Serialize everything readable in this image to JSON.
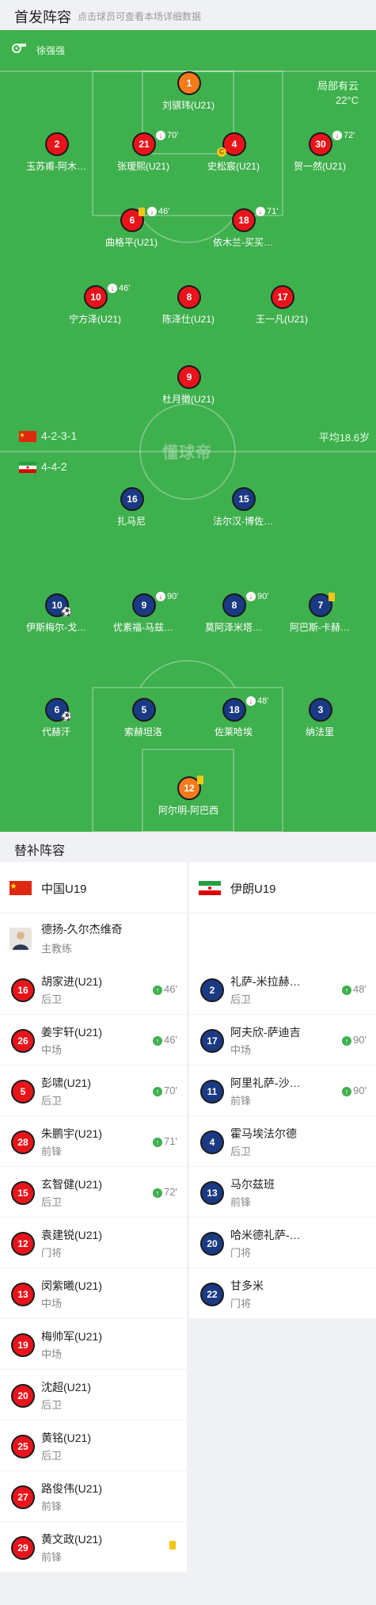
{
  "header": {
    "title": "首发阵容",
    "hint": "点击球员可查看本场详细数据"
  },
  "pitch": {
    "referee": "徐强强",
    "weather": "局部有云",
    "temperature": "22°C",
    "home_formation": "4-2-3-1",
    "away_formation": "4-4-2",
    "home_avg_age": "平均18.6岁",
    "watermark": "懂球帝",
    "home": [
      {
        "num": "1",
        "name": "刘骐玮(U21)",
        "color": "gk"
      },
      {
        "num": "2",
        "name": "玉苏甫-阿木…",
        "color": "red"
      },
      {
        "num": "21",
        "name": "张瑷熙(U21)",
        "color": "red",
        "sub": "70'"
      },
      {
        "num": "4",
        "name": "史松宸(U21)",
        "color": "red",
        "captain": "C"
      },
      {
        "num": "30",
        "name": "贺一然(U21)",
        "color": "red",
        "sub": "72'"
      },
      {
        "num": "6",
        "name": "曲格平(U21)",
        "color": "red",
        "sub": "46'",
        "card": "yellow"
      },
      {
        "num": "18",
        "name": "依木兰-买买…",
        "color": "red",
        "sub": "71'"
      },
      {
        "num": "10",
        "name": "宁方泽(U21)",
        "color": "red",
        "sub": "46'"
      },
      {
        "num": "8",
        "name": "陈泽仕(U21)",
        "color": "red"
      },
      {
        "num": "17",
        "name": "王一凡(U21)",
        "color": "red"
      },
      {
        "num": "9",
        "name": "杜月徵(U21)",
        "color": "red"
      }
    ],
    "away": [
      {
        "num": "16",
        "name": "扎马尼",
        "color": "blue"
      },
      {
        "num": "15",
        "name": "法尔汉-博佐…",
        "color": "blue"
      },
      {
        "num": "10",
        "name": "伊斯梅尔-戈…",
        "color": "blue",
        "goal": "1"
      },
      {
        "num": "9",
        "name": "优素福-马兹…",
        "color": "blue",
        "sub": "90'"
      },
      {
        "num": "8",
        "name": "莫阿泽米塔…",
        "color": "blue",
        "sub": "90'"
      },
      {
        "num": "7",
        "name": "阿巴斯-卡赫…",
        "color": "blue",
        "card": "yellow"
      },
      {
        "num": "6",
        "name": "代赫汗",
        "color": "blue",
        "goal": "1"
      },
      {
        "num": "5",
        "name": "索赫坦洛",
        "color": "blue"
      },
      {
        "num": "18",
        "name": "佐莱哈埃",
        "color": "blue",
        "sub": "48'"
      },
      {
        "num": "3",
        "name": "纳法里",
        "color": "blue"
      },
      {
        "num": "12",
        "name": "阿尔明-阿巴西",
        "color": "gk",
        "card": "yellow"
      }
    ]
  },
  "subs": {
    "title": "替补阵容",
    "home": {
      "team": "中国U19",
      "coach": {
        "name": "德扬-久尔杰维奇",
        "role": "主教练"
      },
      "players": [
        {
          "num": "16",
          "name": "胡家进(U21)",
          "pos": "后卫",
          "in": "46'"
        },
        {
          "num": "26",
          "name": "姜宇轩(U21)",
          "pos": "中场",
          "in": "46'"
        },
        {
          "num": "5",
          "name": "彭啸(U21)",
          "pos": "后卫",
          "in": "70'"
        },
        {
          "num": "28",
          "name": "朱鹏宇(U21)",
          "pos": "前锋",
          "in": "71'"
        },
        {
          "num": "15",
          "name": "玄智健(U21)",
          "pos": "后卫",
          "in": "72'"
        },
        {
          "num": "12",
          "name": "袁建锐(U21)",
          "pos": "门将"
        },
        {
          "num": "13",
          "name": "闵紫曦(U21)",
          "pos": "中场"
        },
        {
          "num": "19",
          "name": "梅帅军(U21)",
          "pos": "中场"
        },
        {
          "num": "20",
          "name": "沈超(U21)",
          "pos": "后卫"
        },
        {
          "num": "25",
          "name": "黄铭(U21)",
          "pos": "后卫"
        },
        {
          "num": "27",
          "name": "路俊伟(U21)",
          "pos": "前锋"
        },
        {
          "num": "29",
          "name": "黄文政(U21)",
          "pos": "前锋",
          "card": "yellow"
        }
      ]
    },
    "away": {
      "team": "伊朗U19",
      "players": [
        {
          "num": "2",
          "name": "礼萨-米拉赫…",
          "pos": "后卫",
          "in": "48'"
        },
        {
          "num": "17",
          "name": "阿夫欣-萨迪吉",
          "pos": "中场",
          "in": "90'"
        },
        {
          "num": "11",
          "name": "阿里礼萨-沙…",
          "pos": "前锋",
          "in": "90'"
        },
        {
          "num": "4",
          "name": "霍马埃法尔德",
          "pos": "后卫"
        },
        {
          "num": "13",
          "name": "马尔兹班",
          "pos": "前锋"
        },
        {
          "num": "20",
          "name": "哈米德礼萨-…",
          "pos": "门将"
        },
        {
          "num": "22",
          "name": "甘多米",
          "pos": "门将"
        }
      ]
    }
  },
  "colors": {
    "pitch": "#3fb04e",
    "home": "#e8141b",
    "away": "#1b3a84",
    "gk": "#f47a1c",
    "card": "#f5c518"
  }
}
